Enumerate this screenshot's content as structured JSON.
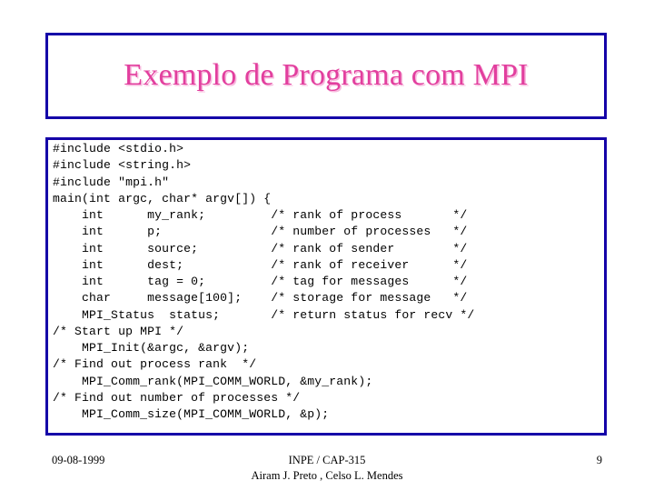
{
  "slide": {
    "title": "Exemplo de Programa com MPI",
    "title_color": "#e23f9e",
    "border_color": "#1400a8",
    "background_color": "#ffffff",
    "code": "#include <stdio.h>\n#include <string.h>\n#include \"mpi.h\"\nmain(int argc, char* argv[]) {\n    int      my_rank;         /* rank of process       */\n    int      p;               /* number of processes   */\n    int      source;          /* rank of sender        */\n    int      dest;            /* rank of receiver      */\n    int      tag = 0;         /* tag for messages      */\n    char     message[100];    /* storage for message   */\n    MPI_Status  status;       /* return status for recv */\n/* Start up MPI */\n    MPI_Init(&argc, &argv);\n/* Find out process rank  */\n    MPI_Comm_rank(MPI_COMM_WORLD, &my_rank);\n/* Find out number of processes */\n    MPI_Comm_size(MPI_COMM_WORLD, &p);",
    "code_lines": [
      "#include <stdio.h>",
      "#include <string.h>",
      "#include \"mpi.h\"",
      "main(int argc, char* argv[]) {",
      "    int      my_rank;         /* rank of process       */",
      "    int      p;               /* number of processes   */",
      "    int      source;          /* rank of sender        */",
      "    int      dest;            /* rank of receiver      */",
      "    int      tag = 0;         /* tag for messages      */",
      "    char     message[100];    /* storage for message   */",
      "    MPI_Status  status;       /* return status for recv */",
      "/* Start up MPI */",
      "    MPI_Init(&argc, &argv);",
      "/* Find out process rank  */",
      "    MPI_Comm_rank(MPI_COMM_WORLD, &my_rank);",
      "/* Find out number of processes */",
      "    MPI_Comm_size(MPI_COMM_WORLD, &p);"
    ]
  },
  "footer": {
    "date": "09-08-1999",
    "course": "INPE / CAP-315",
    "authors": "Airam J. Preto , Celso L. Mendes",
    "page_number": "9"
  }
}
